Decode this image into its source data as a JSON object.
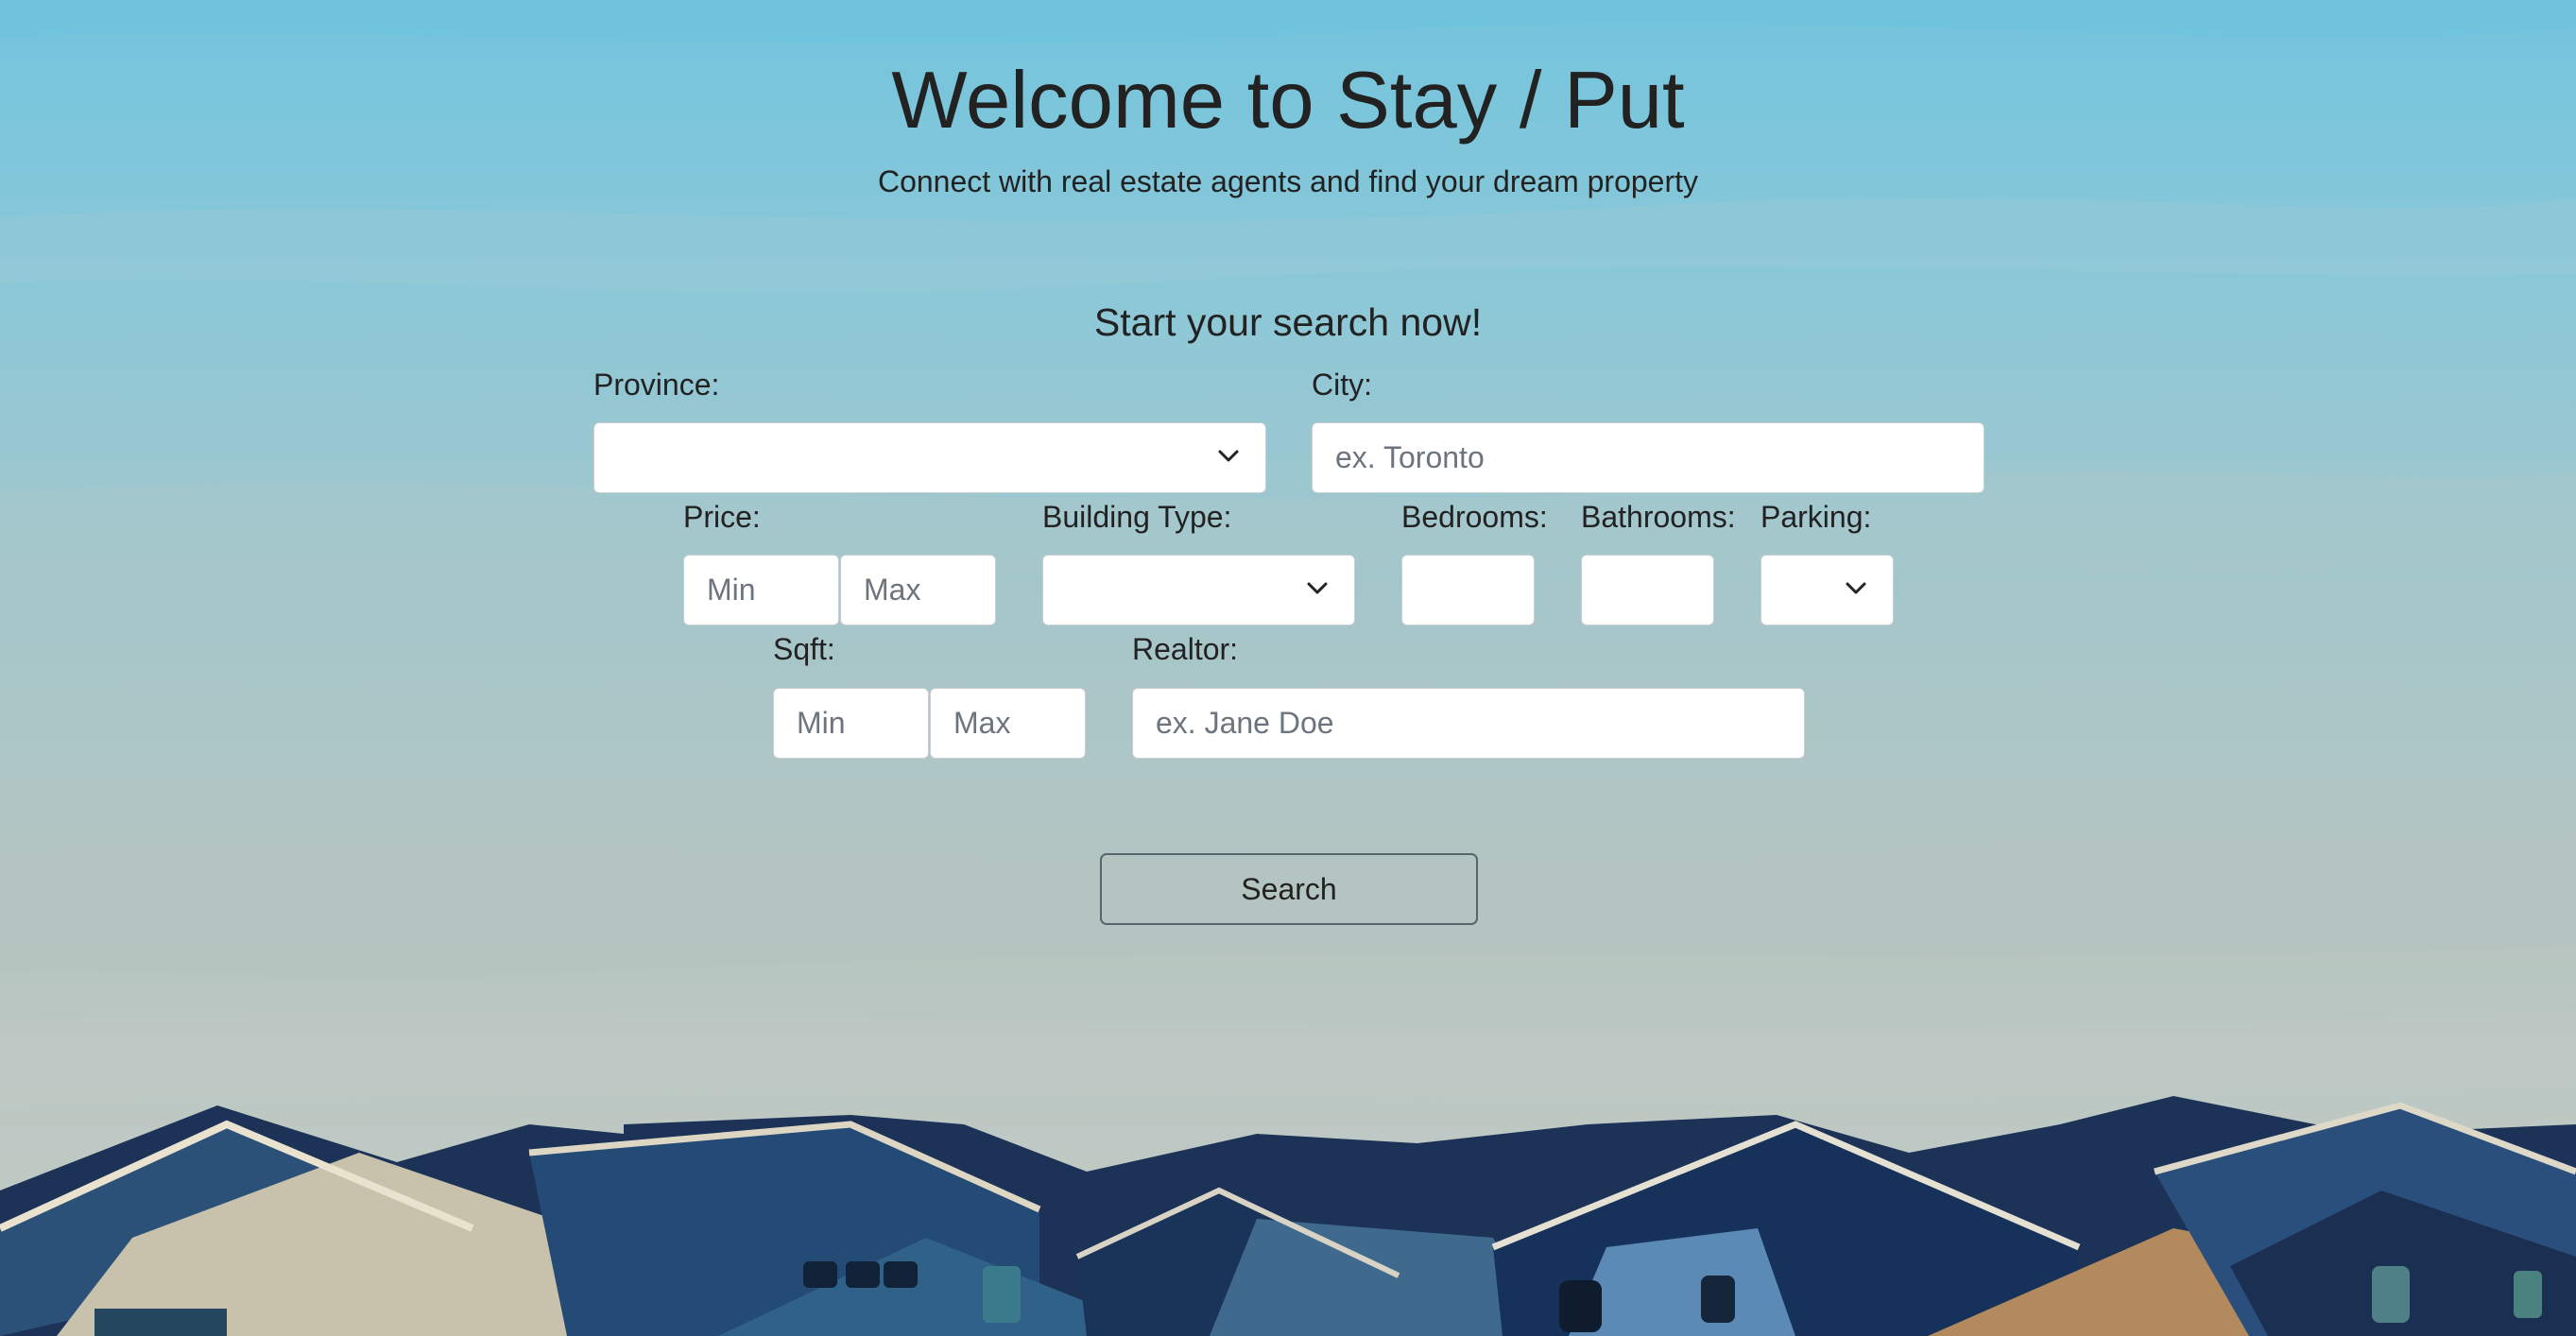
{
  "hero": {
    "title": "Welcome to Stay / Put",
    "subtitle": "Connect with real estate agents and find your dream property"
  },
  "search": {
    "heading": "Start your search now!",
    "province": {
      "label": "Province:",
      "value": ""
    },
    "city": {
      "label": "City:",
      "placeholder": "ex. Toronto"
    },
    "price": {
      "label": "Price:",
      "min_placeholder": "Min",
      "max_placeholder": "Max"
    },
    "building_type": {
      "label": "Building Type:",
      "value": ""
    },
    "bedrooms": {
      "label": "Bedrooms:"
    },
    "bathrooms": {
      "label": "Bathrooms:"
    },
    "parking": {
      "label": "Parking:",
      "value": ""
    },
    "sqft": {
      "label": "Sqft:",
      "min_placeholder": "Min",
      "max_placeholder": "Max"
    },
    "realtor": {
      "label": "Realtor:",
      "placeholder": "ex. Jane Doe"
    },
    "button_label": "Search"
  },
  "icons": {
    "dropdown": "chevron-down-icon",
    "background": "rooftops-illustration"
  },
  "colors": {
    "sky_top": "#72c4dd",
    "sky_bottom": "#c2cbc5",
    "text": "#222222",
    "placeholder": "#6c757d",
    "button_border": "#59646c"
  }
}
